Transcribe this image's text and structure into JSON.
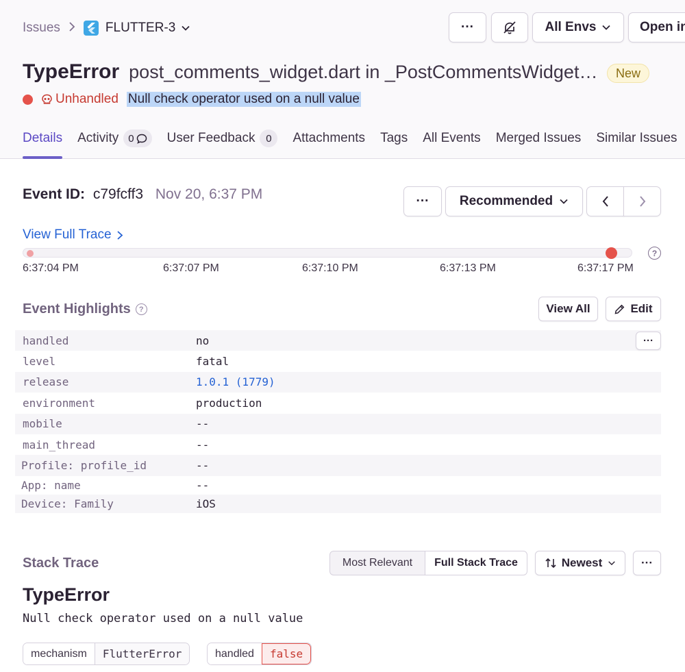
{
  "breadcrumb": {
    "root": "Issues",
    "current": "FLUTTER-3"
  },
  "header_actions": {
    "more": "···",
    "mute_icon": "bell-slash-icon",
    "env": "All Envs",
    "open_in": "Open in"
  },
  "issue": {
    "type": "TypeError",
    "location": "post_comments_widget.dart in _PostCommentsWidgetState",
    "badge": "New",
    "handled_status": "Unhandled",
    "message": "Null check operator used on a null value"
  },
  "tabs": [
    {
      "label": "Details"
    },
    {
      "label": "Activity",
      "count": "0"
    },
    {
      "label": "User Feedback",
      "count": "0"
    },
    {
      "label": "Attachments"
    },
    {
      "label": "Tags"
    },
    {
      "label": "All Events"
    },
    {
      "label": "Merged Issues"
    },
    {
      "label": "Similar Issues"
    }
  ],
  "event": {
    "id_label": "Event ID:",
    "id": "c79fcff3",
    "date": "Nov 20, 6:37 PM",
    "more": "···",
    "sort": "Recommended"
  },
  "trace": {
    "link": "View Full Trace",
    "help": "?",
    "ticks": [
      "6:37:04 PM",
      "6:37:07 PM",
      "6:37:10 PM",
      "6:37:13 PM",
      "6:37:17 PM"
    ]
  },
  "highlights": {
    "title": "Event Highlights",
    "help": "?",
    "view_all": "View All",
    "edit": "Edit",
    "more": "···",
    "rows": [
      {
        "key": "handled",
        "value": "no"
      },
      {
        "key": "level",
        "value": "fatal"
      },
      {
        "key": "release",
        "value": "1.0.1 (1779)"
      },
      {
        "key": "environment",
        "value": "production"
      },
      {
        "key": "mobile",
        "value": "--"
      },
      {
        "key": "main_thread",
        "value": "--"
      },
      {
        "key": "Profile: profile_id",
        "value": "--"
      },
      {
        "key": "App: name",
        "value": "--"
      },
      {
        "key": "Device: Family",
        "value": "iOS"
      }
    ]
  },
  "stack": {
    "title": "Stack Trace",
    "most_relevant": "Most Relevant",
    "full": "Full Stack Trace",
    "order": "Newest",
    "more": "···",
    "exception_type": "TypeError",
    "exception_message": "Null check operator used on a null value",
    "mechanism_key": "mechanism",
    "mechanism_value": "FlutterError",
    "handled_key": "handled",
    "handled_value": "false"
  },
  "colors": {
    "accent": "#6c5fc7",
    "link": "#2562d4",
    "error": "#e5534b"
  }
}
